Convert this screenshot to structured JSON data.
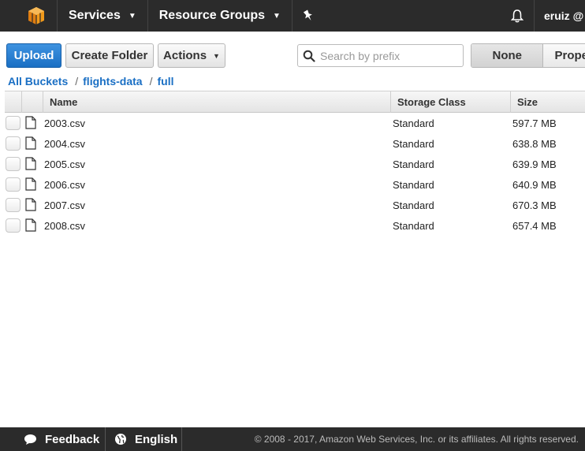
{
  "topnav": {
    "services_label": "Services",
    "resource_groups_label": "Resource Groups",
    "user_label": "eruiz @"
  },
  "toolbar": {
    "upload_label": "Upload",
    "create_folder_label": "Create Folder",
    "actions_label": "Actions",
    "search_placeholder": "Search by prefix",
    "view_none_label": "None",
    "view_properties_label": "Prope"
  },
  "breadcrumb": {
    "items": [
      "All Buckets",
      "flights-data",
      "full"
    ],
    "separator": "/"
  },
  "table": {
    "columns": [
      "Name",
      "Storage Class",
      "Size"
    ],
    "rows": [
      {
        "name": "2003.csv",
        "storage_class": "Standard",
        "size": "597.7 MB"
      },
      {
        "name": "2004.csv",
        "storage_class": "Standard",
        "size": "638.8 MB"
      },
      {
        "name": "2005.csv",
        "storage_class": "Standard",
        "size": "639.9 MB"
      },
      {
        "name": "2006.csv",
        "storage_class": "Standard",
        "size": "640.9 MB"
      },
      {
        "name": "2007.csv",
        "storage_class": "Standard",
        "size": "670.3 MB"
      },
      {
        "name": "2008.csv",
        "storage_class": "Standard",
        "size": "657.4 MB"
      }
    ]
  },
  "footer": {
    "feedback_label": "Feedback",
    "language_label": "English",
    "copyright": "© 2008 - 2017, Amazon Web Services, Inc. or its affiliates. All rights reserved."
  },
  "colors": {
    "nav_bg": "#2b2b2b",
    "primary": "#1a6fc4",
    "logo_orange": "#f29a1a"
  }
}
